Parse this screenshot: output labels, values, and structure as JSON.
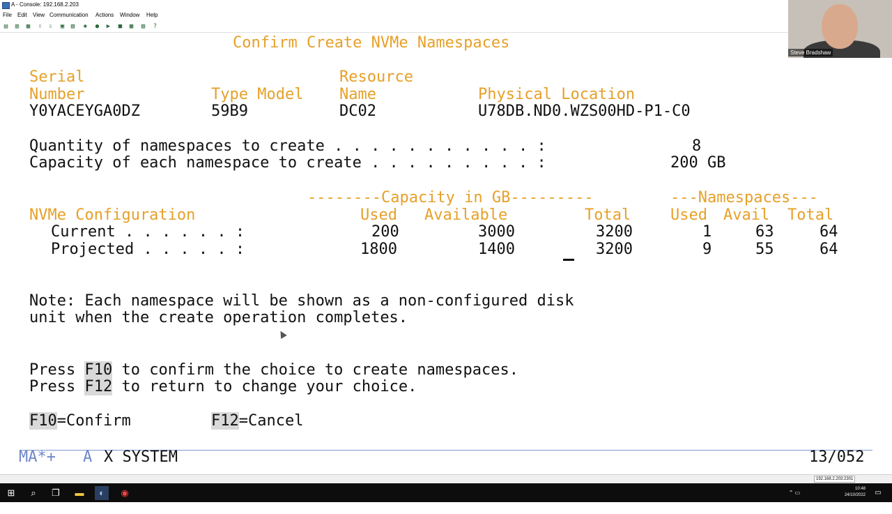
{
  "window": {
    "title": "A - Console: 192.168.2.203"
  },
  "menu": [
    "File",
    "Edit",
    "View",
    "Communication",
    "Actions",
    "Window",
    "Help"
  ],
  "toolbar_icons": [
    "copy-icon",
    "paste-icon",
    "print-icon",
    "upload-icon",
    "download-icon",
    "display-icon",
    "macro-icon",
    "settings-icon",
    "record-icon",
    "play-icon",
    "stop-icon",
    "keypad-icon",
    "map-icon",
    "help-icon"
  ],
  "screen": {
    "title": "Confirm Create NVMe Namespaces",
    "headers": {
      "serial_1": "Serial",
      "serial_2": "Number",
      "type_model": "Type Model",
      "resource_1": "Resource",
      "resource_2": "Name",
      "physical_location": "Physical Location"
    },
    "device": {
      "serial": "Y0YACEYGA0DZ",
      "type_model": "59B9",
      "resource_name": "DC02",
      "physical_location": "U78DB.ND0.WZS00HD-P1-C0"
    },
    "quantity_label": "Quantity of namespaces to create . . . . . . . . . . . :",
    "quantity_value": "8",
    "capacity_label": "Capacity of each namespace to create . . . . . . . . . :",
    "capacity_value": "200 GB",
    "capacity_group": "--------Capacity in GB---------",
    "namespaces_group": "---Namespaces---",
    "table_heading": "NVMe Configuration",
    "col_used": "Used",
    "col_available": "Available",
    "col_total": "Total",
    "col_ns_used": "Used",
    "col_ns_avail": "Avail",
    "col_ns_total": "Total",
    "rows": [
      {
        "label": "Current . . . . . . :",
        "used": "200",
        "available": "3000",
        "total": "3200",
        "ns_used": "1",
        "ns_avail": "63",
        "ns_total": "64"
      },
      {
        "label": "Projected . . . . . :",
        "used": "1800",
        "available": "1400",
        "total": "3200",
        "ns_used": "9",
        "ns_avail": "55",
        "ns_total": "64"
      }
    ],
    "note_1": "Note: Each namespace will be shown as a non-configured disk",
    "note_2": "unit when the create operation completes.",
    "press_1_pre": "Press",
    "press_1_key": "F10",
    "press_1_post": "to confirm the choice to create namespaces.",
    "press_2_pre": "Press",
    "press_2_key": "F12",
    "press_2_post": "to return to change your choice.",
    "fkey_1_key": "F10",
    "fkey_1_label": "=Confirm",
    "fkey_2_key": "F12",
    "fkey_2_label": "=Cancel"
  },
  "oia": {
    "mode": "MA*+",
    "session": "A",
    "system": "X SYSTEM",
    "cursor_pos": "13/052"
  },
  "statusbar": {
    "address": "192.168.2.203:2301"
  },
  "webcam": {
    "name": "Steve Bradshaw"
  },
  "taskbar": {
    "time": "10:48",
    "date": "24/10/2022"
  }
}
